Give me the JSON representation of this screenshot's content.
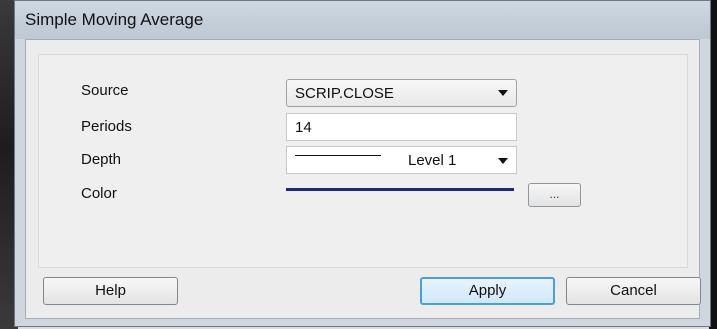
{
  "window": {
    "title": "Simple Moving Average"
  },
  "fields": {
    "source_label": "Source",
    "source_value": "SCRIP.CLOSE",
    "periods_label": "Periods",
    "periods_value": "14",
    "depth_label": "Depth",
    "depth_value": "Level 1",
    "color_label": "Color",
    "color_value": "#1d2a7a",
    "color_picker_label": "..."
  },
  "buttons": {
    "help": "Help",
    "apply": "Apply",
    "cancel": "Cancel"
  },
  "icons": {
    "combo_arrow": "chevron-down-icon"
  }
}
